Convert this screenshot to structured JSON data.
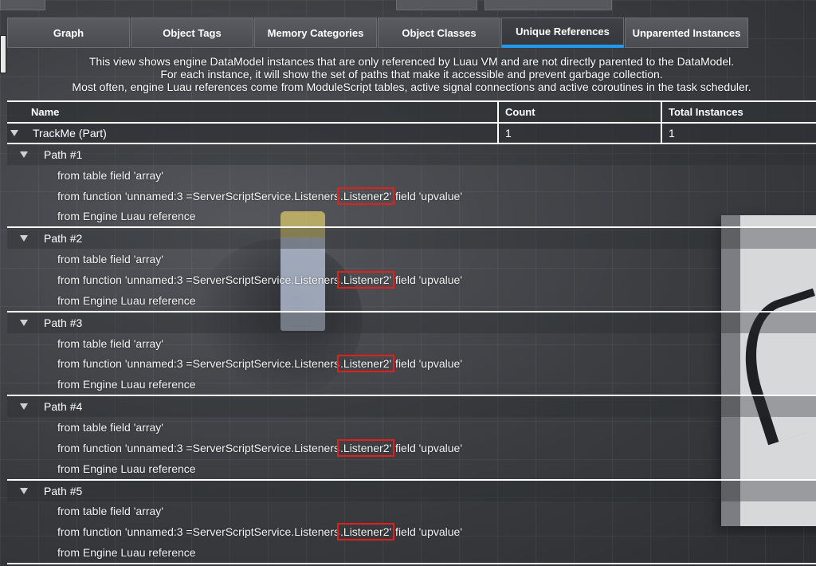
{
  "tabs": [
    {
      "label": "Graph",
      "active": false
    },
    {
      "label": "Object Tags",
      "active": false
    },
    {
      "label": "Memory Categories",
      "active": false
    },
    {
      "label": "Object Classes",
      "active": false
    },
    {
      "label": "Unique References",
      "active": true
    },
    {
      "label": "Unparented Instances",
      "active": false
    }
  ],
  "description": [
    "This view shows engine DataModel instances that are only referenced by Luau VM and are not directly parented to the DataModel.",
    "For each instance, it will show the set of paths that make it accessible and prevent garbage collection.",
    "Most often, engine Luau references come from ModuleScript tables, active signal connections and active coroutines in the task scheduler."
  ],
  "table": {
    "columns": [
      "Name",
      "Count",
      "Total Instances"
    ],
    "instance": {
      "name": "TrackMe (Part)",
      "count": "1",
      "total": "1"
    },
    "paths": [
      {
        "label": "Path #1",
        "lines": [
          "from table field 'array'",
          [
            "from function 'unnamed:3 =ServerScriptService.Listeners",
            ".Listener2'",
            " field 'upvalue'"
          ],
          "from Engine Luau reference"
        ]
      },
      {
        "label": "Path #2",
        "lines": [
          "from table field 'array'",
          [
            "from function 'unnamed:3 =ServerScriptService.Listeners",
            ".Listener2'",
            " field 'upvalue'"
          ],
          "from Engine Luau reference"
        ]
      },
      {
        "label": "Path #3",
        "lines": [
          "from table field 'array'",
          [
            "from function 'unnamed:3 =ServerScriptService.Listeners",
            ".Listener2'",
            " field 'upvalue'"
          ],
          "from Engine Luau reference"
        ]
      },
      {
        "label": "Path #4",
        "lines": [
          "from table field 'array'",
          [
            "from function 'unnamed:3 =ServerScriptService.Listeners",
            ".Listener2'",
            " field 'upvalue'"
          ],
          "from Engine Luau reference"
        ]
      },
      {
        "label": "Path #5",
        "lines": [
          "from table field 'array'",
          [
            "from function 'unnamed:3 =ServerScriptService.Listeners",
            ".Listener2'",
            " field 'upvalue'"
          ],
          "from Engine Luau reference"
        ]
      }
    ]
  },
  "colors": {
    "active_tab_underline": "#1e9bf0",
    "highlight_box": "#e0201a"
  }
}
